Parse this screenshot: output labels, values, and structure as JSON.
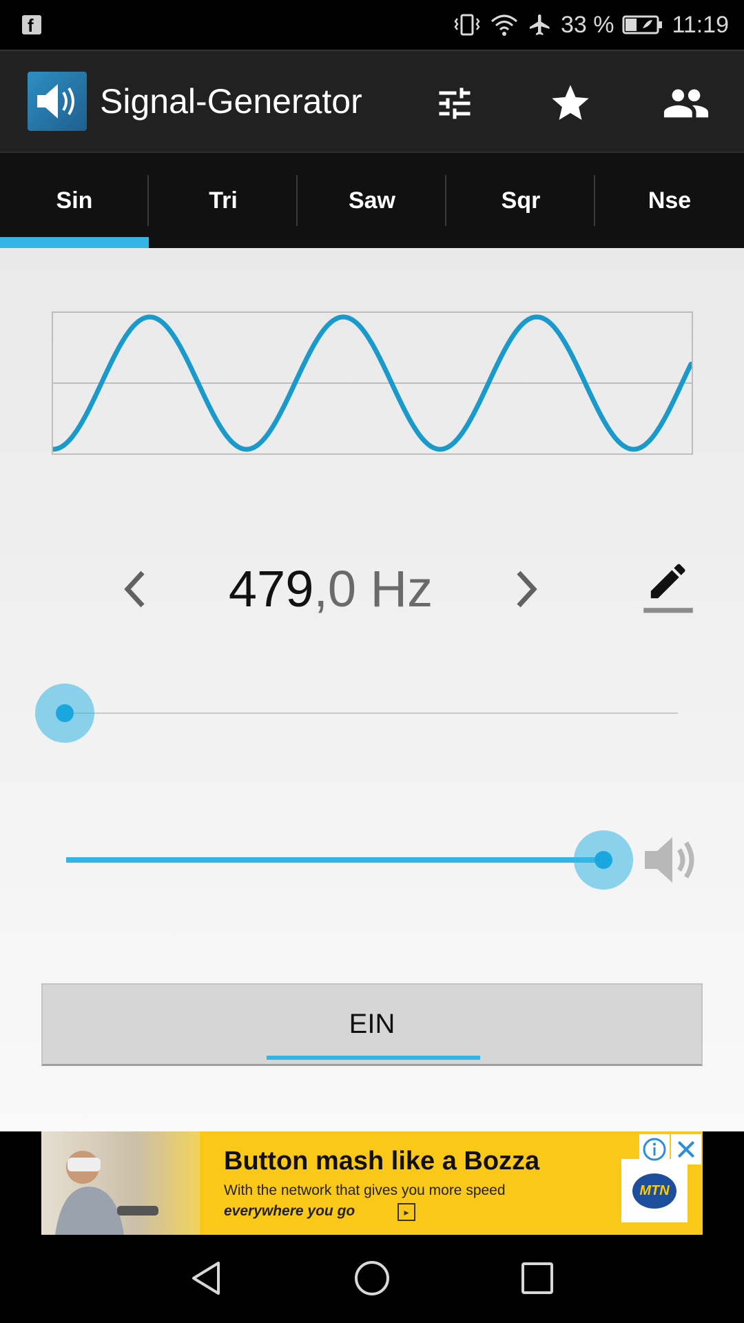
{
  "status_bar": {
    "battery_percent": "33 %",
    "time": "11:19",
    "icons": [
      "facebook-icon",
      "vibrate-icon",
      "wifi-icon",
      "airplane-icon",
      "battery-icon"
    ]
  },
  "app_bar": {
    "title": "Signal-Generator",
    "actions": [
      "equalizer-icon",
      "star-icon",
      "people-icon"
    ]
  },
  "tabs": [
    {
      "label": "Sin",
      "active": true
    },
    {
      "label": "Tri",
      "active": false
    },
    {
      "label": "Saw",
      "active": false
    },
    {
      "label": "Sqr",
      "active": false
    },
    {
      "label": "Nse",
      "active": false
    }
  ],
  "waveform": {
    "type": "sine",
    "cycles_shown": 3.3,
    "color": "#1a9acb"
  },
  "frequency": {
    "integer_part": "479",
    "decimal_part": ",0 Hz"
  },
  "frequency_slider": {
    "level": 0.0
  },
  "volume_slider": {
    "level": 1.0
  },
  "power_button": {
    "label": "EIN"
  },
  "ad": {
    "headline": "Button mash like a Bozza",
    "line1": "With the network that gives you more speed",
    "line2": "everywhere you go",
    "brand": "MTN"
  },
  "colors": {
    "accent": "#33b5e5",
    "wave": "#1a9acb",
    "actionbar": "#212121",
    "tabbar": "#111111"
  }
}
